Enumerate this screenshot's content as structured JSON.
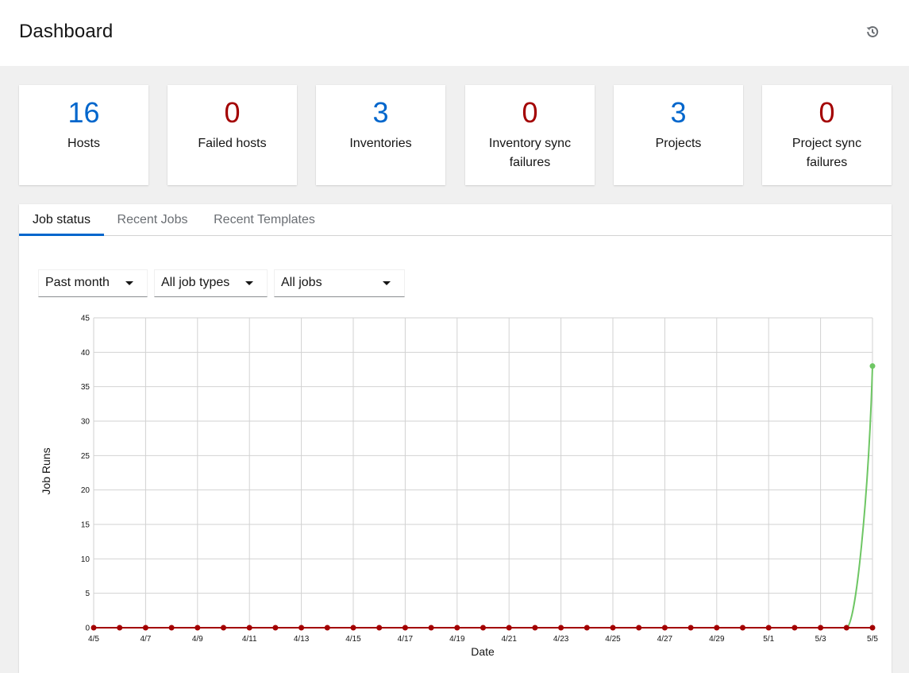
{
  "header": {
    "title": "Dashboard",
    "history_icon": "history-icon"
  },
  "counts": [
    {
      "value": "16",
      "label": "Hosts",
      "color": "#0066cc"
    },
    {
      "value": "0",
      "label": "Failed hosts",
      "color": "#a30000"
    },
    {
      "value": "3",
      "label": "Inventories",
      "color": "#0066cc"
    },
    {
      "value": "0",
      "label": "Inventory sync failures",
      "color": "#a30000"
    },
    {
      "value": "3",
      "label": "Projects",
      "color": "#0066cc"
    },
    {
      "value": "0",
      "label": "Project sync failures",
      "color": "#a30000"
    }
  ],
  "tabs": [
    {
      "label": "Job status",
      "active": true
    },
    {
      "label": "Recent Jobs",
      "active": false
    },
    {
      "label": "Recent Templates",
      "active": false
    }
  ],
  "filters": {
    "period": "Past month",
    "job_type": "All job types",
    "job_status": "All jobs"
  },
  "chart_data": {
    "type": "line",
    "xlabel": "Date",
    "ylabel": "Job Runs",
    "ylim": [
      0,
      45
    ],
    "yticks": [
      0,
      5,
      10,
      15,
      20,
      25,
      30,
      35,
      40,
      45
    ],
    "x": [
      "4/5",
      "4/6",
      "4/7",
      "4/8",
      "4/9",
      "4/10",
      "4/11",
      "4/12",
      "4/13",
      "4/14",
      "4/15",
      "4/16",
      "4/17",
      "4/18",
      "4/19",
      "4/20",
      "4/21",
      "4/22",
      "4/23",
      "4/24",
      "4/25",
      "4/26",
      "4/27",
      "4/28",
      "4/29",
      "4/30",
      "5/1",
      "5/2",
      "5/3",
      "5/4",
      "5/5"
    ],
    "xtick_labels": [
      "4/5",
      "4/7",
      "4/9",
      "4/11",
      "4/13",
      "4/15",
      "4/17",
      "4/19",
      "4/21",
      "4/23",
      "4/25",
      "4/27",
      "4/29",
      "5/1",
      "5/3",
      "5/5"
    ],
    "grid": true,
    "series": [
      {
        "key": "successful",
        "color": "#6ec664",
        "values": [
          0,
          0,
          0,
          0,
          0,
          0,
          0,
          0,
          0,
          0,
          0,
          0,
          0,
          0,
          0,
          0,
          0,
          0,
          0,
          0,
          0,
          0,
          0,
          0,
          0,
          0,
          0,
          0,
          0,
          0,
          38
        ],
        "markers": "last"
      },
      {
        "key": "failed",
        "color": "#a30000",
        "values": [
          0,
          0,
          0,
          0,
          0,
          0,
          0,
          0,
          0,
          0,
          0,
          0,
          0,
          0,
          0,
          0,
          0,
          0,
          0,
          0,
          0,
          0,
          0,
          0,
          0,
          0,
          0,
          0,
          0,
          0,
          0
        ],
        "markers": "all"
      }
    ]
  }
}
